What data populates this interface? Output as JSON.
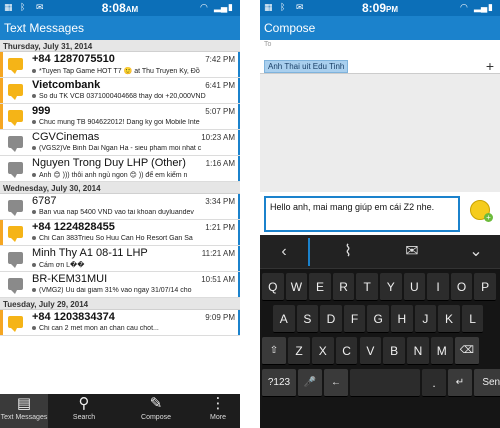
{
  "left": {
    "status_time": "8:08",
    "status_time_suffix": "AM",
    "title": "Text Messages",
    "sections": [
      {
        "date": "Thursday, July 31, 2014",
        "messages": [
          {
            "name": "+84 1287075510",
            "time": "7:42 PM",
            "preview": "*Tuyen Tap Game HOT T7 🙂 at Thu Truyen Ky, Đồ",
            "unread": true
          },
          {
            "name": "Vietcombank",
            "time": "6:41 PM",
            "preview": "So du TK VCB 0371000404668 thay doi +20,000VND",
            "unread": true
          },
          {
            "name": "999",
            "time": "5:07 PM",
            "preview": "Chuc mung TB 904622012! Dang ky goi Mobile Inte",
            "unread": true
          },
          {
            "name": "CGVCinemas",
            "time": "10:23 AM",
            "preview": "(VGS2)Ve Binh Dai Ngan Ha - sieu pham moi nhat c",
            "unread": false
          },
          {
            "name": "Nguyen Trong Duy LHP (Other)",
            "time": "1:16 AM",
            "preview": "Anh 😊 ))) thôi anh ngủ ngon 😊 )) để em kiếm n",
            "unread": false
          }
        ]
      },
      {
        "date": "Wednesday, July 30, 2014",
        "messages": [
          {
            "name": "6787",
            "time": "3:34 PM",
            "preview": "Ban vua nap 5400 VND vao tai khoan duyluandev",
            "unread": false
          },
          {
            "name": "+84 1224828455",
            "time": "1:21 PM",
            "preview": "Chi Can 383Trieu So Huu Can Ho Resort Gan Sa",
            "unread": true
          },
          {
            "name": "Minh Thy A1 08-11 LHP",
            "time": "11:21 AM",
            "preview": "Cám ơn L��",
            "unread": false
          },
          {
            "name": "BR-KEM31MUI",
            "time": "10:51 AM",
            "preview": "(VMG2) Uu dai giam 31% vao ngay 31/07/14 cho",
            "unread": false
          }
        ]
      },
      {
        "date": "Tuesday, July 29, 2014",
        "messages": [
          {
            "name": "+84 1203834374",
            "time": "9:09 PM",
            "preview": "Chi can 2 met mon an chan cau chot...",
            "unread": true
          }
        ]
      }
    ],
    "bottom_bar": [
      {
        "label": "Text Messages",
        "icon": "text-messages-icon"
      },
      {
        "label": "Search",
        "icon": "search-icon"
      },
      {
        "label": "Compose",
        "icon": "compose-icon"
      },
      {
        "label": "More",
        "icon": "more-icon"
      }
    ]
  },
  "right": {
    "status_time": "8:09",
    "status_time_suffix": "PM",
    "title": "Compose",
    "to_label": "To",
    "recipient": "Anh Thai uit Edu Tinh",
    "message_text": "Hello anh, mai mang giúp em cái Z2 nhe.",
    "keyboard": {
      "row1": [
        "Q",
        "W",
        "E",
        "R",
        "T",
        "Y",
        "U",
        "I",
        "O",
        "P"
      ],
      "row2": [
        "A",
        "S",
        "D",
        "F",
        "G",
        "H",
        "J",
        "K",
        "L"
      ],
      "row3": [
        "⇧",
        "Z",
        "X",
        "C",
        "V",
        "B",
        "N",
        "M",
        "⌫"
      ],
      "row4": [
        "?123",
        "🎤",
        "←",
        " ",
        ".",
        "↵",
        "Send"
      ],
      "space_label": "",
      "send_label": "Send",
      "sym_label": "?123"
    }
  },
  "colors": {
    "accent": "#1b82cc",
    "unread": "#f5a623",
    "status": "#0c6fb8"
  }
}
